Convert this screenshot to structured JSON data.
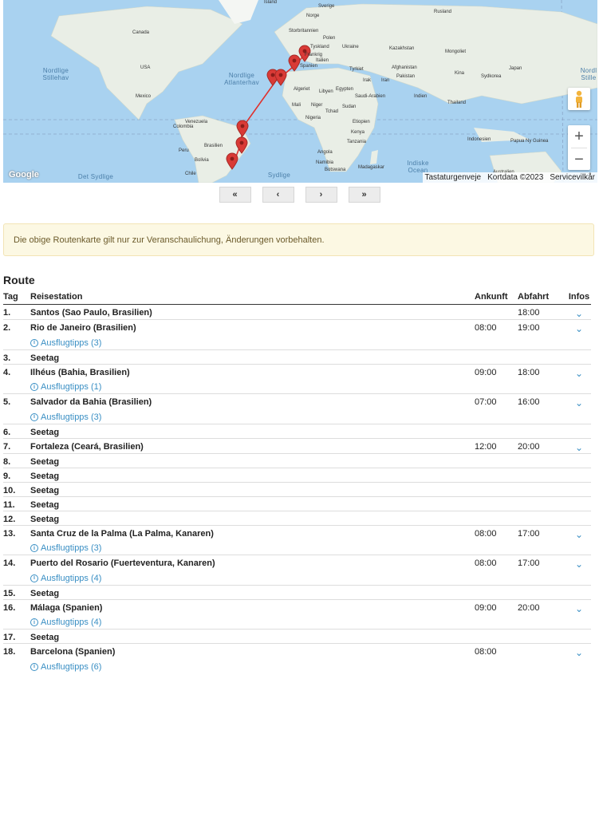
{
  "map": {
    "labels": {
      "island": "Island",
      "norge": "Norge",
      "sverige": "Sverige",
      "rusland": "Rusland",
      "storbritannien": "Storbritannien",
      "tyskland": "Tyskland",
      "polen": "Polen",
      "ukraine": "Ukraine",
      "kazakhstan": "Kazakhstan",
      "mongoliet": "Mongoliet",
      "frankrig": "Frankrig",
      "italien": "Italien",
      "spanien": "Spanien",
      "tyrkiet": "Tyrkiet",
      "afghanistan": "Afghanistan",
      "kina": "Kina",
      "sydkorea": "Sydkorea",
      "japan": "Japan",
      "irak": "Irak",
      "iran": "Iran",
      "pakistan": "Pakistan",
      "canada": "Canada",
      "usa": "USA",
      "mexico": "Mexico",
      "algeriet": "Algeriet",
      "libyen": "Libyen",
      "egypten": "Egypten",
      "saudiarabien": "Saudi-Arabien",
      "indien": "Indien",
      "thailand": "Thailand",
      "mali": "Mali",
      "niger": "Niger",
      "tchad": "Tchad",
      "sudan": "Sudan",
      "nigeria": "Nigeria",
      "etiopien": "Etiopien",
      "venezuela": "Venezuela",
      "colombia": "Colombia",
      "kenya": "Kenya",
      "tanzania": "Tanzania",
      "peru": "Peru",
      "brasilien": "Brasilien",
      "bolivia": "Bolivia",
      "angola": "Angola",
      "indonesien": "Indonesien",
      "papua": "Papua Ny Guinea",
      "namibia": "Namibia",
      "botswana": "Botswana",
      "madagaskar": "Madagaskar",
      "chile": "Chile",
      "australien": "Australien"
    },
    "oceans": {
      "north_pacific_left": "Nordlige Stillehav",
      "north_atlantic": "Nordlige Atlanterhav",
      "north_pacific_right": "Nordl Stille",
      "south_pacific": "Det Sydlige",
      "south_atlantic": "Sydlige",
      "indian_ocean": "Indiske Ocean"
    },
    "google": "Google",
    "attribution": {
      "shortcuts": "Tastaturgenveje",
      "mapdata": "Kortdata ©2023",
      "terms": "Servicevilkår"
    },
    "zoom_in": "+",
    "zoom_out": "−",
    "colors": {
      "route": "#e0302c",
      "marker": "#d93a36",
      "water": "#a9d2f0",
      "land": "#e9eee6"
    }
  },
  "pager": {
    "first": "«",
    "prev": "‹",
    "next": "›",
    "last": "»"
  },
  "notice": "Die obige Routenkarte gilt nur zur Veranschaulichung, Änderungen vorbehalten.",
  "route": {
    "title": "Route",
    "headers": {
      "tag": "Tag",
      "station": "Reisestation",
      "ankunft": "Ankunft",
      "abfahrt": "Abfahrt",
      "infos": "Infos"
    },
    "chevron": "⌄",
    "rows": [
      {
        "tag": "1.",
        "station": "Santos (Sao Paulo, Brasilien)",
        "ankunft": "",
        "abfahrt": "18:00",
        "info": true,
        "tips": ""
      },
      {
        "tag": "2.",
        "station": "Rio de Janeiro (Brasilien)",
        "ankunft": "08:00",
        "abfahrt": "19:00",
        "info": true,
        "tips": "Ausflugtipps (3)"
      },
      {
        "tag": "3.",
        "station": "Seetag",
        "ankunft": "",
        "abfahrt": "",
        "info": false,
        "tips": ""
      },
      {
        "tag": "4.",
        "station": "Ilhéus (Bahia, Brasilien)",
        "ankunft": "09:00",
        "abfahrt": "18:00",
        "info": true,
        "tips": "Ausflugtipps (1)"
      },
      {
        "tag": "5.",
        "station": "Salvador da Bahia (Brasilien)",
        "ankunft": "07:00",
        "abfahrt": "16:00",
        "info": true,
        "tips": "Ausflugtipps (3)"
      },
      {
        "tag": "6.",
        "station": "Seetag",
        "ankunft": "",
        "abfahrt": "",
        "info": false,
        "tips": ""
      },
      {
        "tag": "7.",
        "station": "Fortaleza (Ceará, Brasilien)",
        "ankunft": "12:00",
        "abfahrt": "20:00",
        "info": true,
        "tips": ""
      },
      {
        "tag": "8.",
        "station": "Seetag",
        "ankunft": "",
        "abfahrt": "",
        "info": false,
        "tips": ""
      },
      {
        "tag": "9.",
        "station": "Seetag",
        "ankunft": "",
        "abfahrt": "",
        "info": false,
        "tips": ""
      },
      {
        "tag": "10.",
        "station": "Seetag",
        "ankunft": "",
        "abfahrt": "",
        "info": false,
        "tips": ""
      },
      {
        "tag": "11.",
        "station": "Seetag",
        "ankunft": "",
        "abfahrt": "",
        "info": false,
        "tips": ""
      },
      {
        "tag": "12.",
        "station": "Seetag",
        "ankunft": "",
        "abfahrt": "",
        "info": false,
        "tips": ""
      },
      {
        "tag": "13.",
        "station": "Santa Cruz de la Palma (La Palma, Kanaren)",
        "ankunft": "08:00",
        "abfahrt": "17:00",
        "info": true,
        "tips": "Ausflugtipps (3)"
      },
      {
        "tag": "14.",
        "station": "Puerto del Rosario (Fuerteventura, Kanaren)",
        "ankunft": "08:00",
        "abfahrt": "17:00",
        "info": true,
        "tips": "Ausflugtipps (4)"
      },
      {
        "tag": "15.",
        "station": "Seetag",
        "ankunft": "",
        "abfahrt": "",
        "info": false,
        "tips": ""
      },
      {
        "tag": "16.",
        "station": "Málaga (Spanien)",
        "ankunft": "09:00",
        "abfahrt": "20:00",
        "info": true,
        "tips": "Ausflugtipps (4)"
      },
      {
        "tag": "17.",
        "station": "Seetag",
        "ankunft": "",
        "abfahrt": "",
        "info": false,
        "tips": ""
      },
      {
        "tag": "18.",
        "station": "Barcelona (Spanien)",
        "ankunft": "08:00",
        "abfahrt": "",
        "info": true,
        "tips": "Ausflugtipps (6)"
      }
    ]
  }
}
